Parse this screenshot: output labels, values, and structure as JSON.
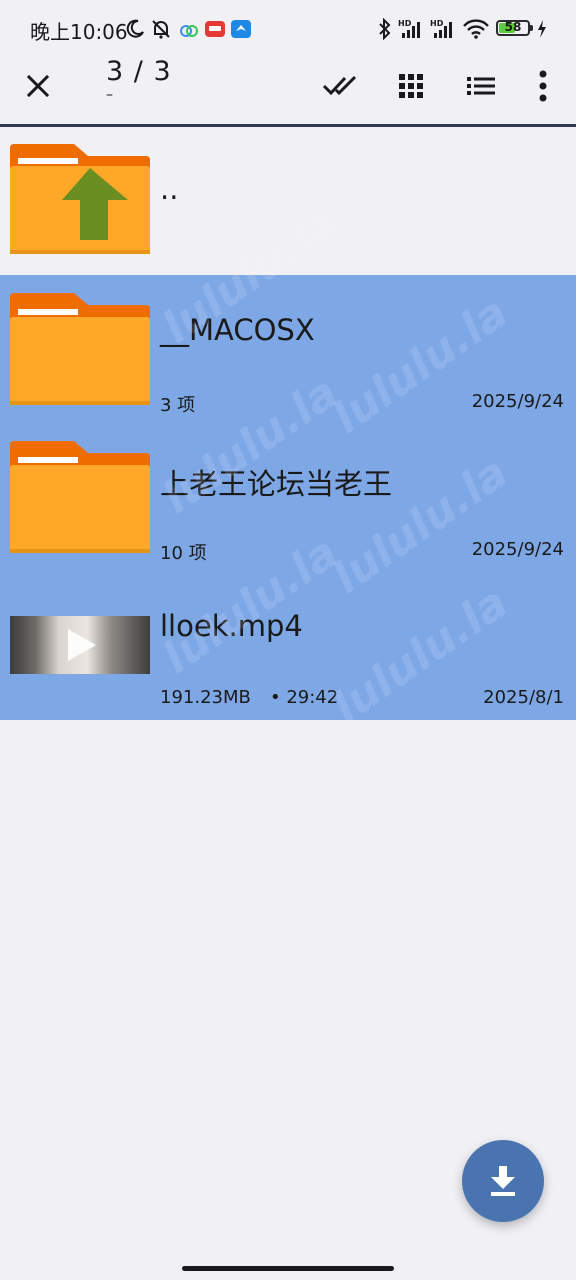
{
  "status_bar": {
    "time": "晚上10:06",
    "battery": "58",
    "battery_level": 0.58
  },
  "toolbar": {
    "selection_count": "3 / 3",
    "selection_sub": "–",
    "icons": [
      "close-icon",
      "select-all-icon",
      "grid-view-icon",
      "list-view-icon",
      "more-icon"
    ]
  },
  "files": [
    {
      "name": "..",
      "type": "parent-folder",
      "selected": false
    },
    {
      "name": "__MACOSX",
      "type": "folder",
      "items": "3 项",
      "date": "2025/9/24",
      "selected": true
    },
    {
      "name": "上老王论坛当老王",
      "type": "folder",
      "items": "10 项",
      "date": "2025/9/24",
      "selected": true
    },
    {
      "name": "lloek.mp4",
      "type": "video",
      "size": "191.23MB",
      "duration": "• 29:42",
      "date": "2025/8/1",
      "selected": true
    }
  ],
  "fab": {
    "icon": "download-icon"
  },
  "colors": {
    "selection": "#7ea7e6",
    "folder": "#ffa726",
    "folder_tab": "#ef6c00",
    "up_arrow": "#6b8e23",
    "fab": "#4a74b0",
    "background": "#f0f0f5"
  }
}
